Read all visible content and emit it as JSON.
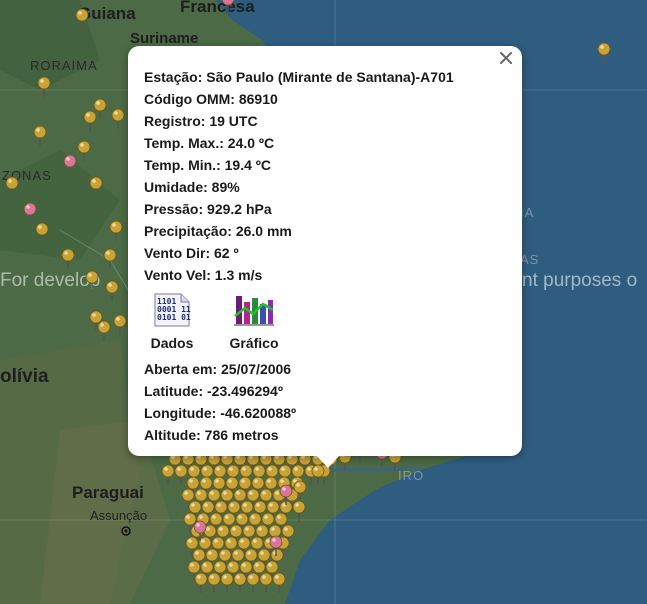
{
  "map": {
    "labels": {
      "guiana": "Guiana",
      "francesa": "Francesa",
      "suriname": "Suriname",
      "roraima": "RORAIMA",
      "amazonas": "ZONAS",
      "bolivia": "olívia",
      "paraguai": "Paraguai",
      "assuncao": "Assunção",
      "janeiro": "IRO",
      "bahia": "IA",
      "minas": "AS"
    },
    "watermark_left": "For develop",
    "watermark_right": "nt purposes o"
  },
  "popup": {
    "close_icon": "close-icon",
    "station": "Estação: São Paulo (Mirante de Santana)-A701",
    "omm": "Código OMM: 86910",
    "registro": "Registro: 19 UTC",
    "temp_max": "Temp. Max.: 24.0 ºC",
    "temp_min": "Temp. Min.: 19.4 ºC",
    "umidade": "Umidade: 89%",
    "pressao": "Pressão: 929.2 hPa",
    "precipitacao": "Precipitação: 26.0 mm",
    "vento_dir": "Vento Dir: 62 º",
    "vento_vel": "Vento Vel: 1.3 m/s",
    "dados_label": "Dados",
    "dados_icon": "binary-data-icon",
    "grafico_label": "Gráfico",
    "grafico_icon": "bar-chart-icon",
    "aberta": "Aberta em: 25/07/2006",
    "latitude": "Latitude: -23.496294º",
    "longitude": "Longitude: -46.620088º",
    "altitude": "Altitude: 786 metros"
  },
  "colors": {
    "ocean": "#2f5d80",
    "land": "#4a6b45",
    "pin_gold": "#c9a435",
    "pin_pink": "#d9749a"
  }
}
